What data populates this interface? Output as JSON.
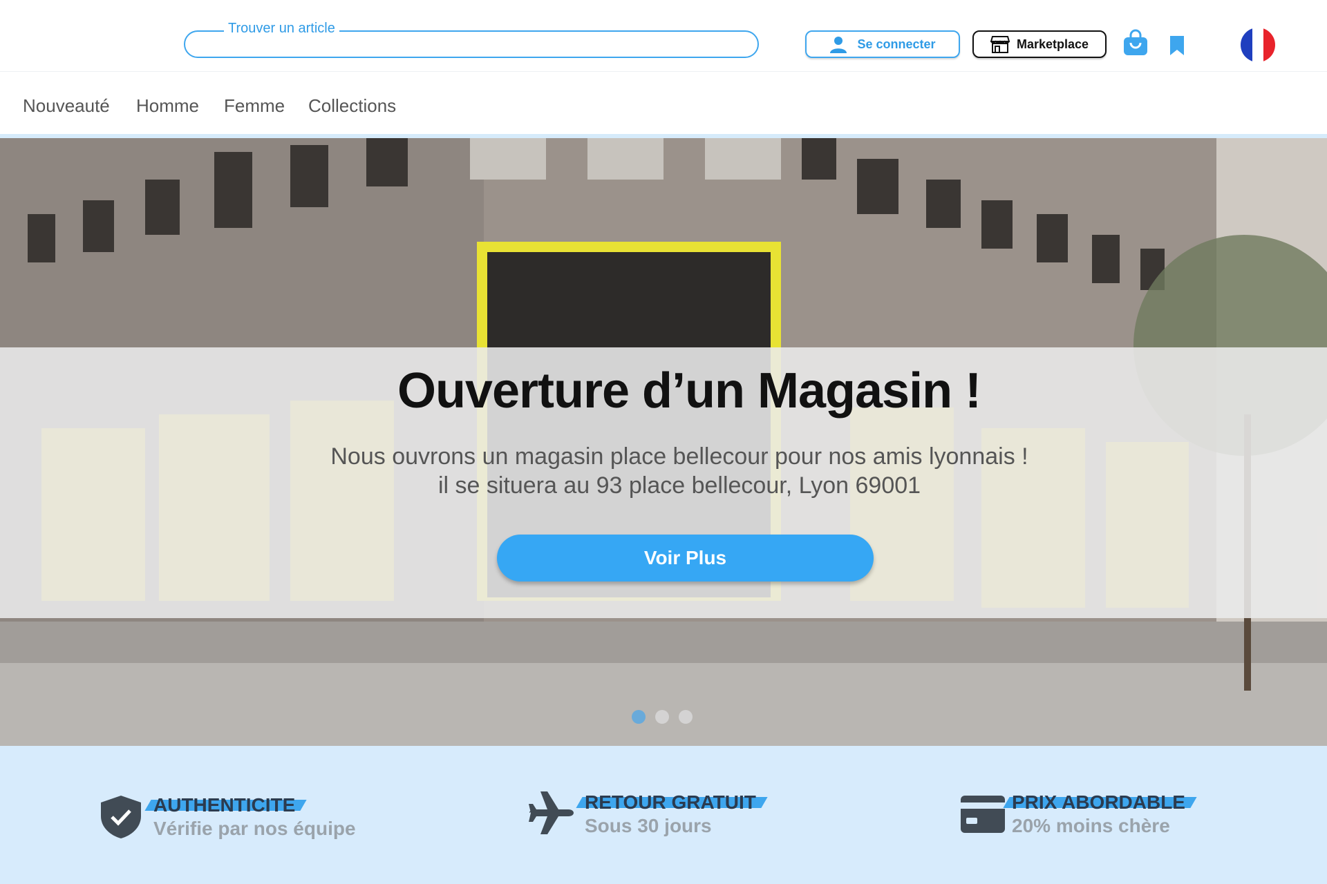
{
  "header": {
    "search_legend": "Trouver un article",
    "search_value": "",
    "connect_label": "Se connecter",
    "marketplace_label": "Marketplace",
    "flag_colors": [
      "#1f3fbf",
      "#ffffff",
      "#e8232b"
    ]
  },
  "nav": {
    "items": [
      "Nouveauté",
      "Homme",
      "Femme",
      "Collections"
    ]
  },
  "hero": {
    "title": "Ouverture d’un Magasin !",
    "subtitle_line1": "Nous ouvrons un magasin place bellecour pour nos amis lyonnais !",
    "subtitle_line2": "il se situera au 93 place bellecour, Lyon 69001",
    "button_label": "Voir Plus",
    "carousel_active": 1,
    "carousel_count": 3
  },
  "features": [
    {
      "title": "AUTHENTICITE",
      "subtitle": "Vérifie par nos équipe",
      "icon": "shield-check-icon"
    },
    {
      "title": "RETOUR GRATUIT",
      "subtitle": "Sous 30 jours",
      "icon": "airplane-icon"
    },
    {
      "title": "PRIX ABORDABLE",
      "subtitle": "20% moins chère",
      "icon": "credit-card-icon"
    }
  ],
  "colors": {
    "accent": "#36a7f4",
    "feature_bg": "#d7ebfc",
    "feature_icon": "#414b55"
  }
}
